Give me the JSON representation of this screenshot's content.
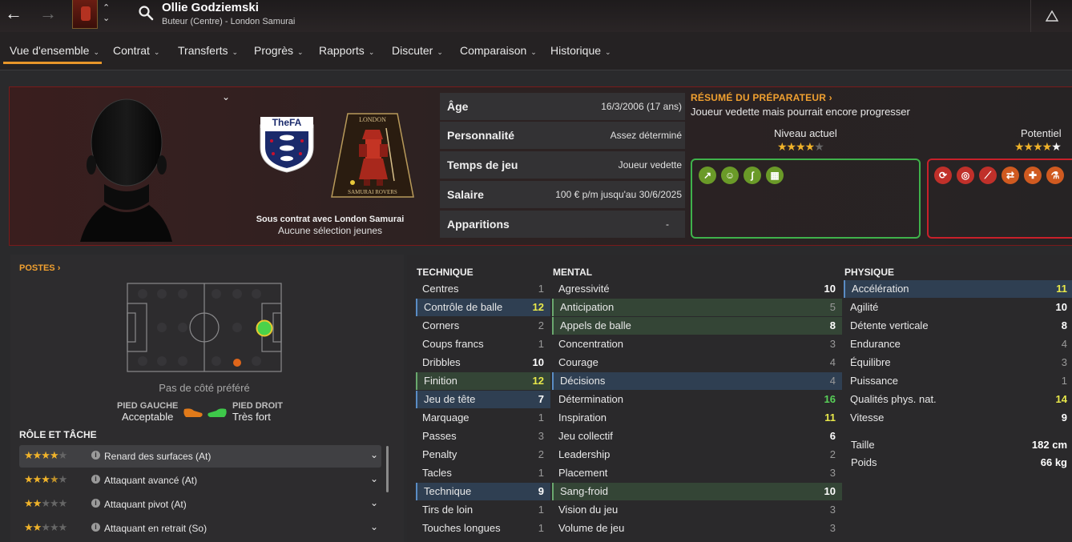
{
  "header": {
    "player_name": "Ollie Godziemski",
    "player_subtitle": "Buteur (Centre) - London Samurai"
  },
  "menu": {
    "tabs": [
      {
        "label": "Vue d'ensemble"
      },
      {
        "label": "Contrat"
      },
      {
        "label": "Transferts"
      },
      {
        "label": "Progrès"
      },
      {
        "label": "Rapports"
      },
      {
        "label": "Discuter"
      },
      {
        "label": "Comparaison"
      },
      {
        "label": "Historique"
      }
    ]
  },
  "profile": {
    "eng_badge_text": "TheFA",
    "club_badge_top": "LONDON",
    "club_badge_bottom": "SAMURAI ROVERS",
    "contract_line": "Sous contrat avec London Samurai",
    "youth_line": "Aucune sélection jeunes"
  },
  "info": [
    {
      "label": "Âge",
      "value": "16/3/2006 (17 ans)"
    },
    {
      "label": "Personnalité",
      "value": "Assez déterminé"
    },
    {
      "label": "Temps de jeu",
      "value": "Joueur vedette"
    },
    {
      "label": "Salaire",
      "value": "100 € p/m jusqu'au 30/6/2025"
    },
    {
      "label": "Apparitions",
      "value": "-"
    }
  ],
  "coach": {
    "title": "RÉSUMÉ DU PRÉPARATEUR",
    "summary": "Joueur vedette mais pourrait encore progresser",
    "current_label": "Niveau actuel",
    "current_stars": 4,
    "potential_label": "Potentiel",
    "potential_stars": 4.5
  },
  "positions": {
    "title": "POSTES",
    "side_pref": "Pas de côté préféré",
    "left_foot_label": "PIED GAUCHE",
    "left_foot_value": "Acceptable",
    "right_foot_label": "PIED DROIT",
    "right_foot_value": "Très fort"
  },
  "roles": {
    "title": "RÔLE ET TÂCHE",
    "items": [
      {
        "name": "Renard des surfaces (At)",
        "stars": 4
      },
      {
        "name": "Attaquant avancé (At)",
        "stars": 3.5
      },
      {
        "name": "Attaquant pivot (At)",
        "stars": 2
      },
      {
        "name": "Attaquant en retrait (So)",
        "stars": 2
      }
    ]
  },
  "attributes": {
    "technique_title": "TECHNIQUE",
    "technique": [
      {
        "name": "Centres",
        "value": "1"
      },
      {
        "name": "Contrôle de balle",
        "value": "12"
      },
      {
        "name": "Corners",
        "value": "2"
      },
      {
        "name": "Coups francs",
        "value": "1"
      },
      {
        "name": "Dribbles",
        "value": "10"
      },
      {
        "name": "Finition",
        "value": "12"
      },
      {
        "name": "Jeu de tête",
        "value": "7"
      },
      {
        "name": "Marquage",
        "value": "1"
      },
      {
        "name": "Passes",
        "value": "3"
      },
      {
        "name": "Penalty",
        "value": "2"
      },
      {
        "name": "Tacles",
        "value": "1"
      },
      {
        "name": "Technique",
        "value": "9"
      },
      {
        "name": "Tirs de loin",
        "value": "1"
      },
      {
        "name": "Touches longues",
        "value": "1"
      }
    ],
    "mental_title": "MENTAL",
    "mental": [
      {
        "name": "Agressivité",
        "value": "10"
      },
      {
        "name": "Anticipation",
        "value": "5"
      },
      {
        "name": "Appels de balle",
        "value": "8"
      },
      {
        "name": "Concentration",
        "value": "3"
      },
      {
        "name": "Courage",
        "value": "4"
      },
      {
        "name": "Décisions",
        "value": "4"
      },
      {
        "name": "Détermination",
        "value": "16"
      },
      {
        "name": "Inspiration",
        "value": "11"
      },
      {
        "name": "Jeu collectif",
        "value": "6"
      },
      {
        "name": "Leadership",
        "value": "2"
      },
      {
        "name": "Placement",
        "value": "3"
      },
      {
        "name": "Sang-froid",
        "value": "10"
      },
      {
        "name": "Vision du jeu",
        "value": "3"
      },
      {
        "name": "Volume de jeu",
        "value": "3"
      }
    ],
    "physical_title": "PHYSIQUE",
    "physical": [
      {
        "name": "Accélération",
        "value": "11"
      },
      {
        "name": "Agilité",
        "value": "10"
      },
      {
        "name": "Détente verticale",
        "value": "8"
      },
      {
        "name": "Endurance",
        "value": "4"
      },
      {
        "name": "Équilibre",
        "value": "3"
      },
      {
        "name": "Puissance",
        "value": "1"
      },
      {
        "name": "Qualités phys. nat.",
        "value": "14"
      },
      {
        "name": "Vitesse",
        "value": "9"
      }
    ],
    "height_label": "Taille",
    "height_value": "182 cm",
    "weight_label": "Poids",
    "weight_value": "66 kg"
  },
  "colors": {
    "accent": "#e8962a",
    "strength_border": "#3fb24b",
    "weakness_border": "#c8202a"
  }
}
